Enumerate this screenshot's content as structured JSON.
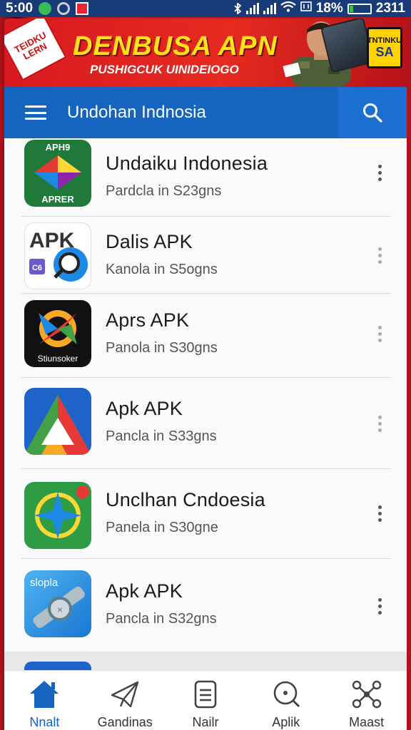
{
  "status_bar": {
    "time": "5:00",
    "battery": "18%",
    "clock_right": "2311"
  },
  "banner": {
    "title": "DENBUSA APN",
    "subtitle": "PUSHIGCUK UINIDEIOGO",
    "sticker_line1": "TEIDKU",
    "sticker_line2": "LERN",
    "badge_top": "TNTINKU",
    "badge_main": "SA"
  },
  "app_bar": {
    "title": "Undohan Indnosia"
  },
  "apps": [
    {
      "name": "Undaiku Indonesia",
      "sub": "Pardcla  in  S23gns",
      "icon": "apk-prism-icon",
      "icon_text_top": "APH9",
      "icon_text_bottom": "APRER"
    },
    {
      "name": "Dalis APK",
      "sub": "Kanola  in  S5ogns",
      "icon": "apk-magnifier-icon",
      "icon_text_top": "APK",
      "icon_text_bottom": "C6"
    },
    {
      "name": "Aprs APK",
      "sub": "Panola  in  S30gns",
      "icon": "compass-burst-icon",
      "icon_text_bottom": "Stiunsoker"
    },
    {
      "name": "Apk APK",
      "sub": "Pancla  in  S33gns",
      "icon": "triangle-drive-icon"
    },
    {
      "name": "Unclhan Cndoesia",
      "sub": "Panela  in  S30gne",
      "icon": "compass-star-icon"
    },
    {
      "name": "Apk APK",
      "sub": "Pancla  in  S32gns",
      "icon": "wrench-magnifier-icon",
      "icon_text_top": "slopla"
    }
  ],
  "bottom_nav": [
    {
      "label": "Nnalt",
      "icon": "home-icon",
      "active": true
    },
    {
      "label": "Gandinas",
      "icon": "paper-plane-icon",
      "active": false
    },
    {
      "label": "Nailr",
      "icon": "document-icon",
      "active": false
    },
    {
      "label": "Aplik",
      "icon": "search-circle-icon",
      "active": false
    },
    {
      "label": "Maast",
      "icon": "share-nodes-icon",
      "active": false
    }
  ],
  "colors": {
    "app_bar": "#1565c0",
    "banner_red": "#d71920",
    "banner_yellow": "#ffe21a",
    "nav_active": "#1565c0"
  }
}
